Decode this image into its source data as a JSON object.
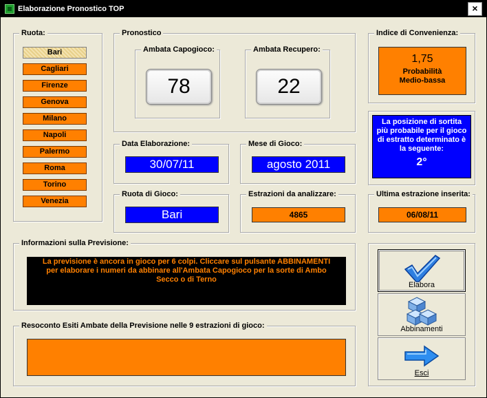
{
  "window": {
    "title": "Elaborazione Pronostico TOP",
    "close_label": "×"
  },
  "ruota_group": {
    "legend": "Ruota:",
    "items": [
      "Bari",
      "Cagliari",
      "Firenze",
      "Genova",
      "Milano",
      "Napoli",
      "Palermo",
      "Roma",
      "Torino",
      "Venezia"
    ],
    "selected": "Bari"
  },
  "pronostico": {
    "legend": "Pronostico",
    "capogioco_legend": "Ambata Capogioco:",
    "capogioco_value": "78",
    "recupero_legend": "Ambata Recupero:",
    "recupero_value": "22"
  },
  "indice": {
    "legend": "Indice di Convenienza:",
    "value": "1,75",
    "label_line1": "Probabilità",
    "label_line2": "Medio-bassa"
  },
  "posizione": {
    "line1": "La posizione di sortita",
    "line2": "più probabile per il gioco",
    "line3": "di estratto determinato è",
    "line4": "la seguente:",
    "value": "2°"
  },
  "data_elaborazione": {
    "legend": "Data Elaborazione:",
    "value": "30/07/11"
  },
  "mese_gioco": {
    "legend": "Mese di Gioco:",
    "value": "agosto 2011"
  },
  "ruota_gioco": {
    "legend": "Ruota di Gioco:",
    "value": "Bari"
  },
  "estrazioni": {
    "legend": "Estrazioni da analizzare:",
    "value": "4865"
  },
  "ultima_estrazione": {
    "legend": "Ultima estrazione inserita:",
    "value": "06/08/11"
  },
  "informazioni": {
    "legend": "Informazioni sulla Previsione:",
    "line1": "La previsione è ancora in gioco per 6 colpi. Cliccare sul pulsante ABBINAMENTI",
    "line2": "per elaborare i numeri da abbinare all'Ambata Capogioco per la sorte di Ambo",
    "line3": "Secco o di Terno"
  },
  "resoconto": {
    "legend": "Resoconto Esiti Ambate della Previsione nelle 9 estrazioni di gioco:",
    "value": ""
  },
  "buttons": {
    "elabora": "Elabora",
    "abbinamenti": "Abbinamenti",
    "esci": "Esci"
  },
  "colors": {
    "orange": "#ff8000",
    "blue": "#0000ff",
    "black_panel": "#000000",
    "info_text": "#ff8000"
  }
}
